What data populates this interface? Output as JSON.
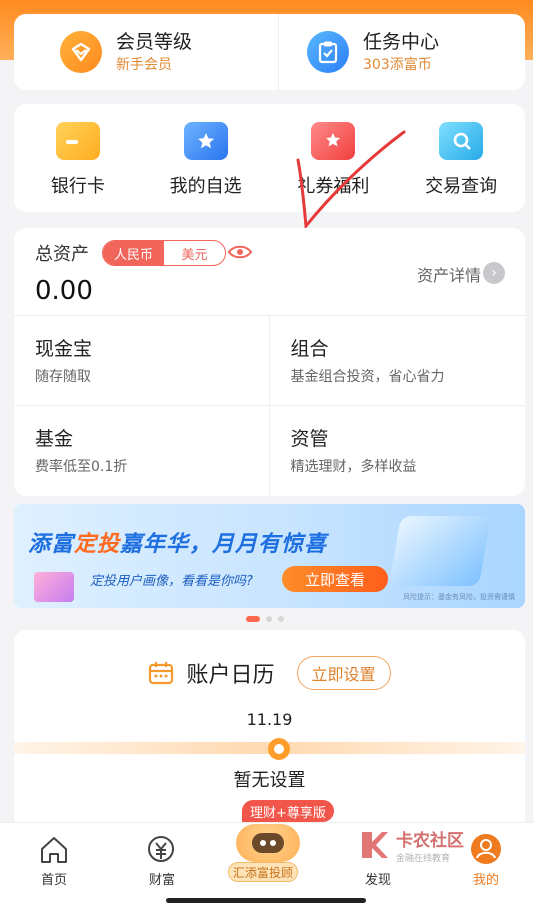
{
  "member": {
    "level": {
      "title": "会员等级",
      "sub": "新手会员"
    },
    "tasks": {
      "title": "任务中心",
      "sub": "303添富币"
    }
  },
  "quick_nav": [
    {
      "label": "银行卡",
      "icon": "bank-card-icon"
    },
    {
      "label": "我的自选",
      "icon": "favorites-icon"
    },
    {
      "label": "礼券福利",
      "icon": "coupon-icon"
    },
    {
      "label": "交易查询",
      "icon": "transaction-search-icon"
    }
  ],
  "assets": {
    "title": "总资产",
    "currency_active": "人民币",
    "currency_inactive": "美元",
    "value": "0.00",
    "detail_label": "资产详情",
    "items": [
      {
        "title": "现金宝",
        "sub": "随存随取"
      },
      {
        "title": "组合",
        "sub": "基金组合投资，省心省力"
      },
      {
        "title": "基金",
        "sub": "费率低至0.1折"
      },
      {
        "title": "资管",
        "sub": "精选理财，多样收益"
      }
    ]
  },
  "banner": {
    "title_a": "添富",
    "title_b": "定投",
    "title_c": "嘉年华，月月有惊喜",
    "sub": "定投用户画像，看看是你吗?",
    "button": "立即查看",
    "risk": "风险提示：基金有风险，投资需谨慎"
  },
  "calendar": {
    "title": "账户日历",
    "button": "立即设置",
    "date": "11.19",
    "empty": "暂无设置"
  },
  "tabbar": {
    "home": "首页",
    "wealth": "财富",
    "center_badge": "理财+尊享版",
    "center": "汇添富投顾",
    "discover": "发现",
    "mine": "我的"
  },
  "watermark": {
    "text": "卡农社区",
    "sub": "金融在线教育"
  },
  "colors": {
    "brand_orange": "#ff8a1f",
    "accent_red": "#f2655a",
    "link_blue": "#1e6fe0"
  }
}
